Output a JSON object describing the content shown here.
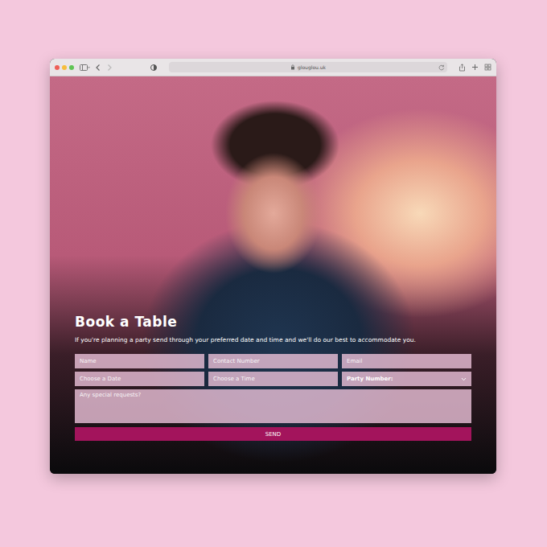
{
  "browser": {
    "url": "glouglou.uk",
    "back_enabled": true,
    "forward_enabled": false
  },
  "booking": {
    "title": "Book a Table",
    "description": "If you're planning a party send through your preferred date and time and we'll do our best to accommodate you.",
    "fields": [
      {
        "kind": "input",
        "placeholder": "Name"
      },
      {
        "kind": "input",
        "placeholder": "Contact Number"
      },
      {
        "kind": "input",
        "placeholder": "Email"
      },
      {
        "kind": "input",
        "placeholder": "Choose a Date"
      },
      {
        "kind": "input",
        "placeholder": "Choose a Time"
      },
      {
        "kind": "select",
        "label": "Party Number:"
      }
    ],
    "requests_placeholder": "Any special requests?",
    "submit": "SEND"
  }
}
